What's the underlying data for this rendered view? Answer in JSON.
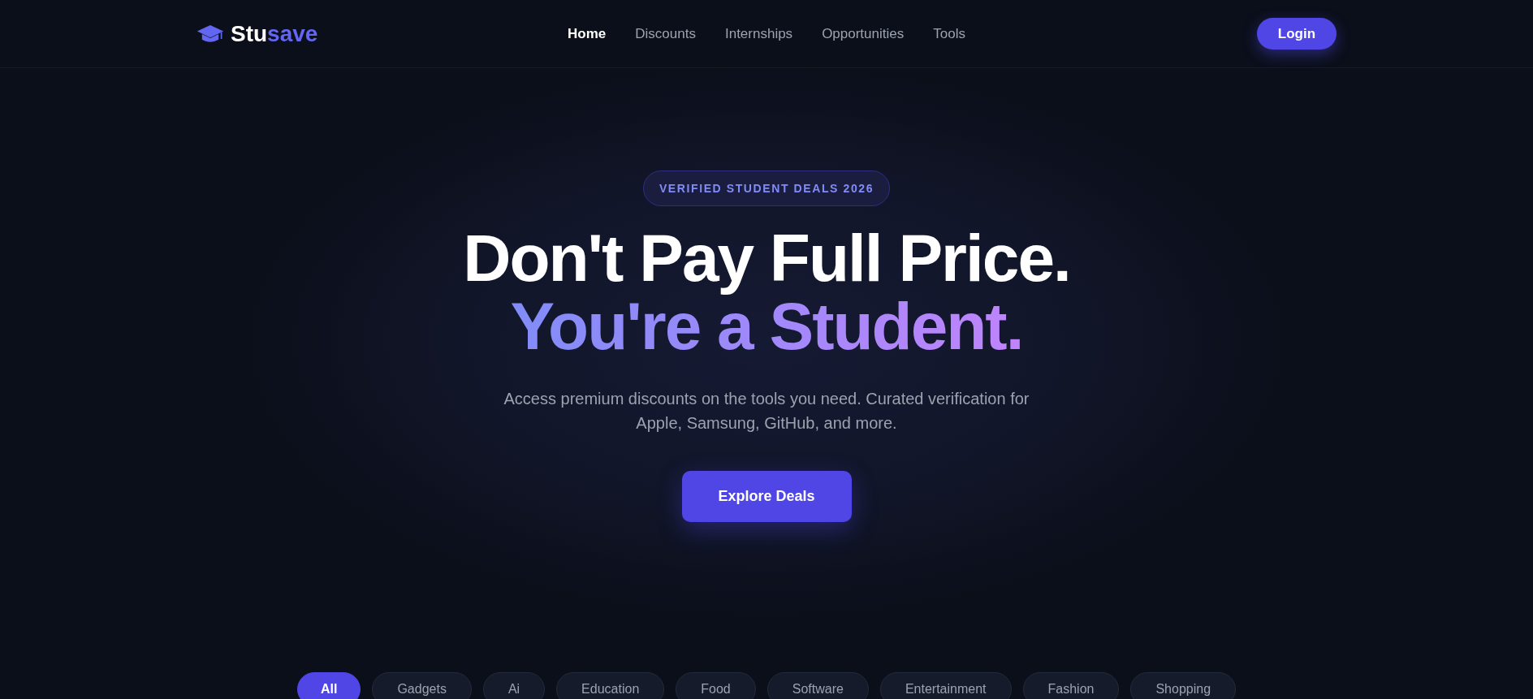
{
  "brand": {
    "name_part1": "Stu",
    "name_part2": "save"
  },
  "nav": [
    {
      "label": "Home",
      "selected": true
    },
    {
      "label": "Discounts",
      "selected": false
    },
    {
      "label": "Internships",
      "selected": false
    },
    {
      "label": "Opportunities",
      "selected": false
    },
    {
      "label": "Tools",
      "selected": false
    }
  ],
  "login_button": "Login",
  "hero": {
    "badge": "VERIFIED STUDENT DEALS 2026",
    "title_line1": "Don't Pay Full Price.",
    "title_line2": "You're a Student.",
    "subtitle": "Access premium discounts on the tools you need. Curated verification for Apple, Samsung, GitHub, and more.",
    "cta": "Explore Deals"
  },
  "categories": [
    {
      "label": "All",
      "selected": true
    },
    {
      "label": "Gadgets",
      "selected": false
    },
    {
      "label": "Ai",
      "selected": false
    },
    {
      "label": "Education",
      "selected": false
    },
    {
      "label": "Food",
      "selected": false
    },
    {
      "label": "Software",
      "selected": false
    },
    {
      "label": "Entertainment",
      "selected": false
    },
    {
      "label": "Fashion",
      "selected": false
    },
    {
      "label": "Shopping",
      "selected": false
    }
  ]
}
